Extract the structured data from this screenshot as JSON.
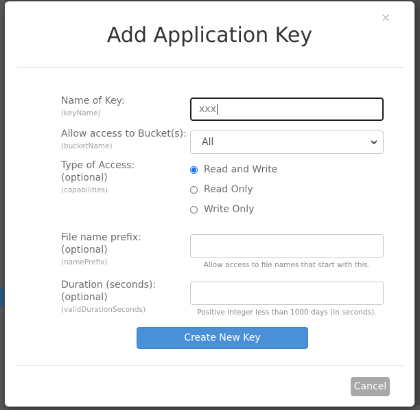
{
  "modal": {
    "title": "Add Application Key",
    "close_label": "×"
  },
  "fields": {
    "key_name": {
      "label": "Name of Key:",
      "param": "(keyName)",
      "value": "xxx"
    },
    "bucket": {
      "label": "Allow access to Bucket(s):",
      "param": "(bucketName)",
      "selected": "All"
    },
    "access_type": {
      "label_line1": "Type of Access:",
      "label_line2": "(optional)",
      "param": "(capabilities)",
      "options": [
        {
          "label": "Read and Write",
          "checked": true
        },
        {
          "label": "Read Only",
          "checked": false
        },
        {
          "label": "Write Only",
          "checked": false
        }
      ]
    },
    "name_prefix": {
      "label_line1": "File name prefix:",
      "label_line2": "(optional)",
      "param": "(namePrefix)",
      "value": "",
      "help": "Allow access to file names that start with this."
    },
    "duration": {
      "label_line1": "Duration (seconds):",
      "label_line2": "(optional)",
      "param": "(validDurationSeconds)",
      "value": "",
      "help": "Positive integer less than 1000 days (in seconds)."
    }
  },
  "actions": {
    "create_label": "Create New Key",
    "cancel_label": "Cancel"
  },
  "colors": {
    "primary": "#4a90d9",
    "cancel": "#a8a8a8",
    "radio_checked": "#1a73e8"
  }
}
